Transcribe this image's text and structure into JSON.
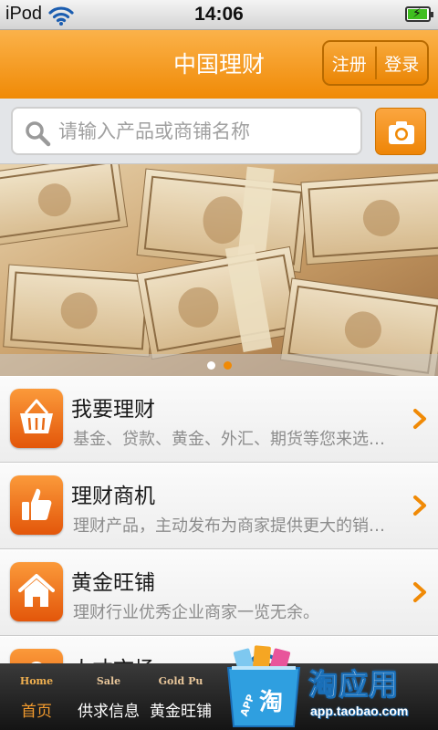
{
  "statusbar": {
    "carrier": "iPod",
    "time": "14:06",
    "battery_level": 0.95
  },
  "header": {
    "title": "中国理财",
    "register_label": "注册",
    "login_label": "登录"
  },
  "search": {
    "placeholder": "请输入产品或商铺名称"
  },
  "banner": {
    "page_count": 2,
    "active_page": 2
  },
  "menu": {
    "items": [
      {
        "title": "我要理财",
        "subtitle": "基金、贷款、黄金、外汇、期货等您来选…",
        "icon": "basket-icon"
      },
      {
        "title": "理财商机",
        "subtitle": "理财产品，主动发布为商家提供更大的销…",
        "icon": "thumbs-up-icon"
      },
      {
        "title": "黄金旺铺",
        "subtitle": "理财行业优秀企业商家一览无余。",
        "icon": "home-icon"
      },
      {
        "title": "人才市场",
        "subtitle": "",
        "icon": "person-icon"
      }
    ]
  },
  "tabbar": {
    "tabs": [
      {
        "en": "Home",
        "cn": "首页"
      },
      {
        "en": "Sale",
        "cn": "供求信息"
      },
      {
        "en": "Gold Pu",
        "cn": "黄金旺铺"
      }
    ]
  },
  "watermark": {
    "title": "淘应用",
    "url": "app.taobao.com",
    "bag_label": "APP"
  },
  "colors": {
    "accent": "#f08a06",
    "tab_active": "#f29a2d"
  }
}
